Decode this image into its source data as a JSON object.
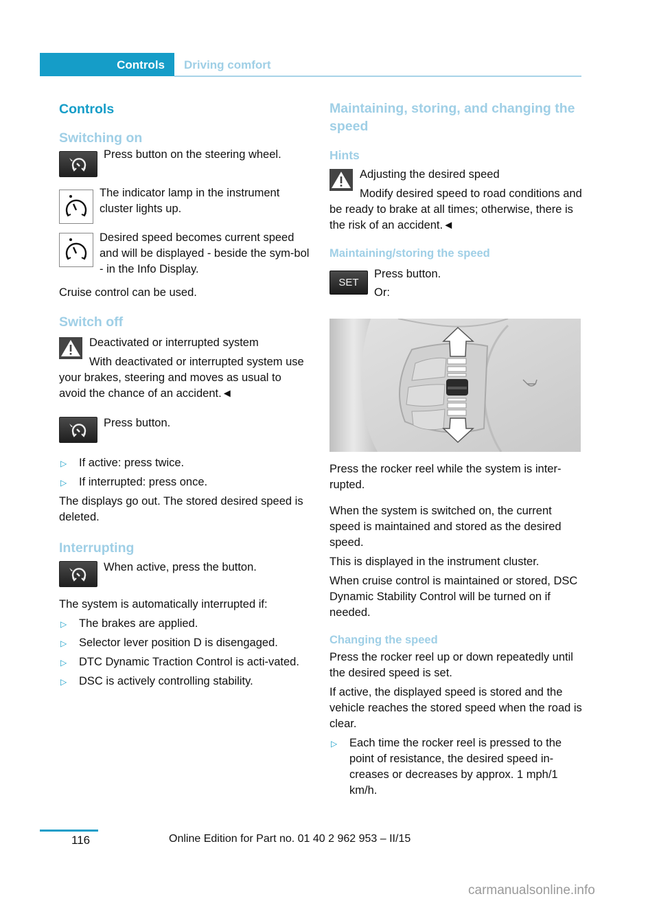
{
  "header": {
    "chapter": "Controls",
    "section": "Driving comfort"
  },
  "left": {
    "title": "Controls",
    "switching_on": {
      "heading": "Switching on",
      "step1": "Press button on the steering wheel.",
      "step2": "The indicator lamp in the instrument cluster lights up.",
      "step3": "Desired speed becomes current speed and will be displayed - beside the sym-bol - in the Info Display.",
      "note": "Cruise control can be used."
    },
    "switch_off": {
      "heading": "Switch off",
      "warning_title": "Deactivated or interrupted system",
      "warning_text": "With deactivated or interrupted system use your brakes, steering and moves as usual to avoid the chance of an accident.◄",
      "step": "Press button.",
      "bullets": [
        "If active: press twice.",
        "If interrupted: press once."
      ],
      "after": "The displays go out. The stored desired speed is deleted."
    },
    "interrupting": {
      "heading": "Interrupting",
      "step": "When active, press the button.",
      "intro": "The system is automatically interrupted if:",
      "bullets": [
        "The brakes are applied.",
        "Selector lever position D is disengaged.",
        "DTC Dynamic Traction Control is acti-vated.",
        "DSC is actively controlling stability."
      ]
    }
  },
  "right": {
    "title": "Maintaining, storing, and changing the speed",
    "hints": {
      "heading": "Hints",
      "warning_title": "Adjusting the desired speed",
      "warning_text": "Modify desired speed to road conditions and be ready to brake at all times; otherwise, there is the risk of an accident.◄"
    },
    "maintaining": {
      "heading": "Maintaining/storing the speed",
      "set_label": "SET",
      "step": "Press button.",
      "or": "Or:",
      "figure_alt": "Steering wheel rocker reel with up/down arrows",
      "p1": "Press the rocker reel while the system is inter-rupted.",
      "p2": "When the system is switched on, the current speed is maintained and stored as the desired speed.",
      "p3": "This is displayed in the instrument cluster.",
      "p4": "When cruise control is maintained or stored, DSC Dynamic Stability Control will be turned on if needed."
    },
    "changing": {
      "heading": "Changing the speed",
      "p1": "Press the rocker reel up or down repeatedly until the desired speed is set.",
      "p2": "If active, the displayed speed is stored and the vehicle reaches the stored speed when the road is clear.",
      "bullets": [
        "Each time the rocker reel is pressed to the point of resistance, the desired speed in-creases or decreases by approx. 1 mph/1 km/h."
      ]
    }
  },
  "footer": {
    "page_number": "116",
    "edition": "Online Edition for Part no. 01 40 2 962 953 – II/15",
    "watermark": "carmanualsonline.info"
  },
  "colors": {
    "accent": "#159dc8",
    "subheading": "#9fcfe6"
  }
}
